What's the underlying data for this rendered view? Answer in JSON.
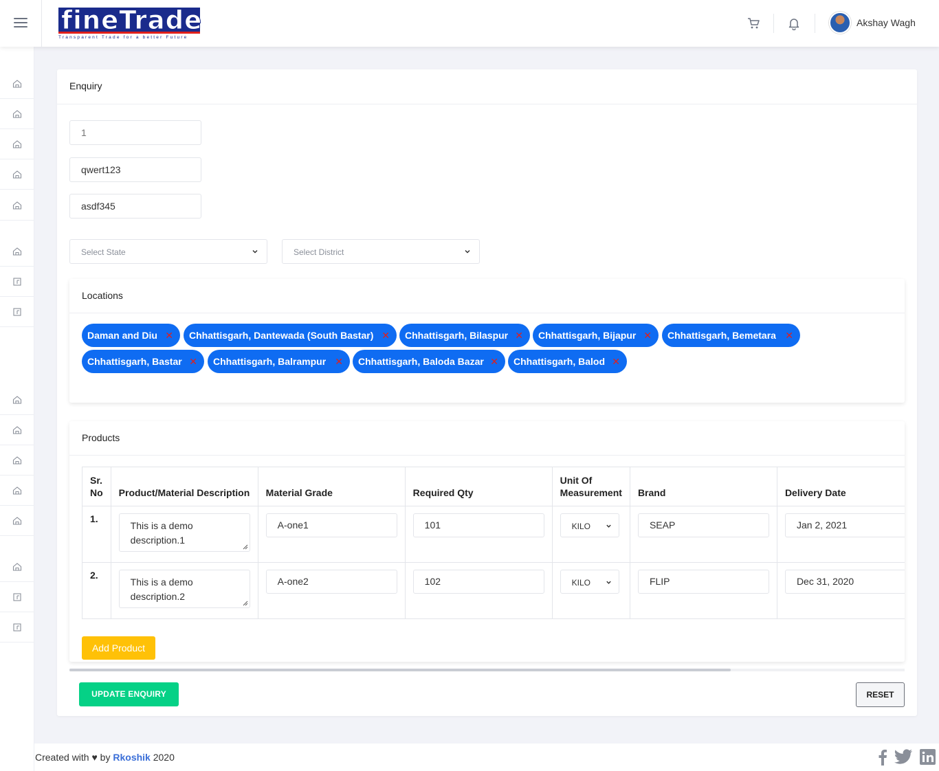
{
  "header": {
    "logo_text": "fineTrade",
    "logo_tagline": "Transparent Trade for a better Future",
    "user_name": "Akshay Wagh",
    "icons": [
      "menu-icon",
      "cart-icon",
      "bell-icon"
    ]
  },
  "sidebar": {
    "icons": [
      "home-icon",
      "home-icon",
      "home-icon",
      "home-icon",
      "home-icon",
      "home-icon",
      "box-icon",
      "box-icon",
      "home-icon",
      "home-icon",
      "home-icon",
      "home-icon",
      "home-icon",
      "home-icon",
      "box-icon",
      "box-icon"
    ]
  },
  "enquiry": {
    "title": "Enquiry",
    "field1_placeholder": "1",
    "field2_value": "qwert123",
    "field3_value": "asdf345",
    "state_placeholder": "Select State",
    "district_placeholder": "Select District"
  },
  "locations": {
    "title": "Locations",
    "remove_symbol": "✕",
    "tags": [
      "Daman and Diu",
      "Chhattisgarh, Dantewada (South Bastar)",
      "Chhattisgarh, Bilaspur",
      "Chhattisgarh, Bijapur",
      "Chhattisgarh, Bemetara",
      "Chhattisgarh, Bastar",
      "Chhattisgarh, Balrampur",
      "Chhattisgarh, Baloda Bazar",
      "Chhattisgarh, Balod"
    ]
  },
  "products": {
    "title": "Products",
    "columns": {
      "sr_no": "Sr. No",
      "description": "Product/Material Description",
      "grade": "Material Grade",
      "qty": "Required Qty",
      "uom": "Unit Of Measurement",
      "brand": "Brand",
      "delivery": "Delivery Date"
    },
    "rows": [
      {
        "sr": "1.",
        "description": "This is a demo description.1",
        "grade": "A-one1",
        "qty": "101",
        "uom": "KILO",
        "brand": "SEAP",
        "delivery": "Jan 2, 2021"
      },
      {
        "sr": "2.",
        "description": "This is a demo description.2",
        "grade": "A-one2",
        "qty": "102",
        "uom": "KILO",
        "brand": "FLIP",
        "delivery": "Dec 31, 2020"
      }
    ],
    "add_label": "Add Product"
  },
  "actions": {
    "update_label": "UPDATE ENQUIRY",
    "reset_label": "RESET"
  },
  "footer": {
    "prefix": "Created with ♥ by",
    "author": "Rkoshik",
    "year": "2020",
    "social": [
      "facebook-icon",
      "twitter-icon",
      "linkedin-icon"
    ]
  },
  "colors": {
    "tag_blue": "#0f6cf2",
    "update_green": "#05d186",
    "add_yellow": "#ffc107",
    "remove_red": "#e0201b"
  }
}
